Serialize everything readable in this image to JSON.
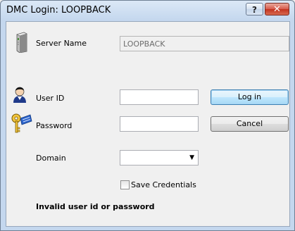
{
  "window": {
    "title": "DMC Login: LOOPBACK",
    "help_label": "?",
    "close_label": "✕"
  },
  "form": {
    "server_label": "Server Name",
    "server_value": "LOOPBACK",
    "userid_label": "User ID",
    "userid_value": "",
    "password_label": "Password",
    "password_value": "",
    "domain_label": "Domain",
    "domain_value": "",
    "save_credentials_label": "Save Credentials",
    "save_credentials_checked": false,
    "error_message": "Invalid user id or password"
  },
  "buttons": {
    "login_label": "Log in",
    "cancel_label": "Cancel"
  },
  "icons": {
    "server": "server-icon",
    "user": "user-icon",
    "password": "key-icon"
  }
}
